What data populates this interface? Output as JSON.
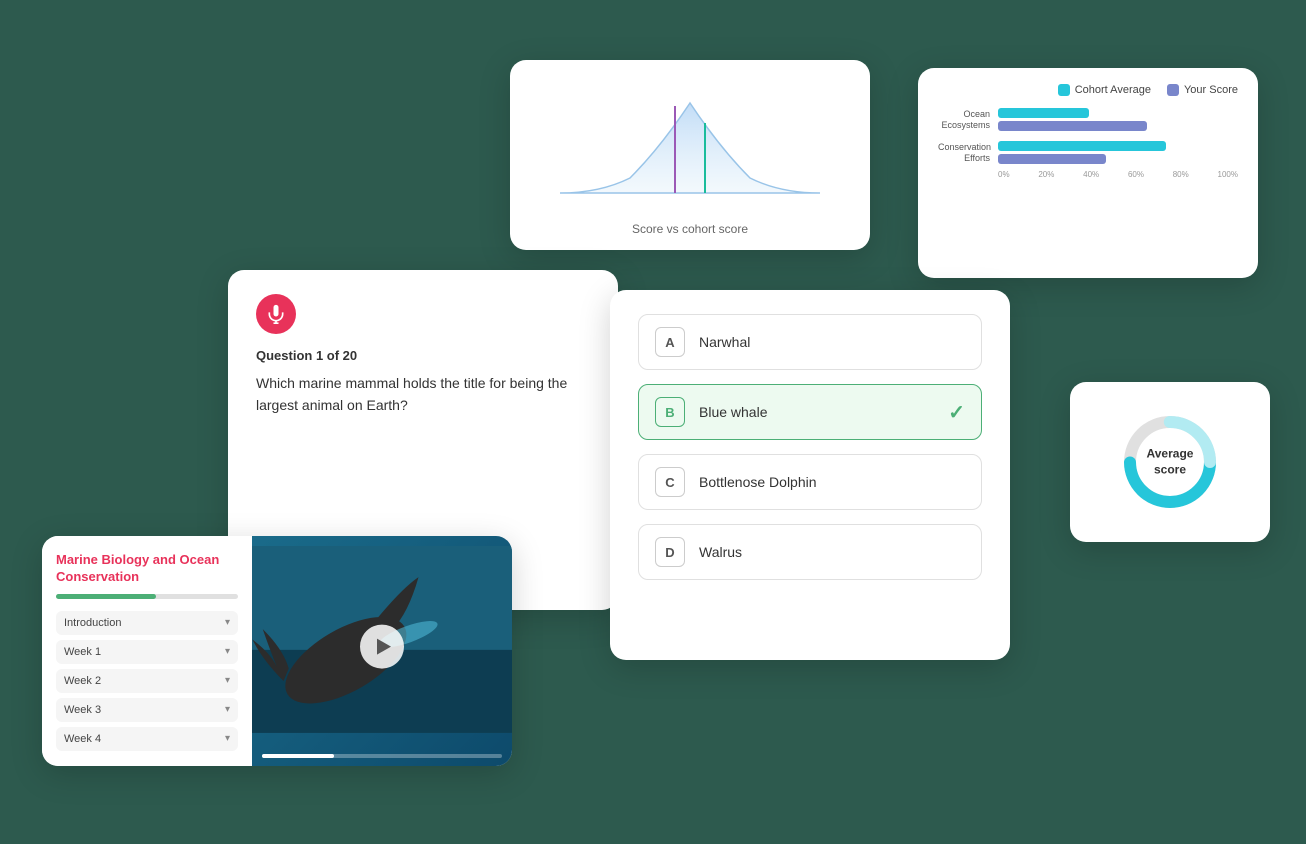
{
  "scoreCohort": {
    "label": "Score vs cohort score"
  },
  "barChart": {
    "legend": {
      "cohortColor": "#26c6da",
      "yourScoreColor": "#7986cb",
      "cohortLabel": "Cohort Average",
      "yourScoreLabel": "Your Score"
    },
    "rows": [
      {
        "label": "Ocean\nEcosystems",
        "cohortWidth": "38%",
        "yourWidth": "62%"
      },
      {
        "label": "Conservation\nEfforts",
        "cohortWidth": "70%",
        "yourWidth": "45%"
      }
    ],
    "axisLabels": [
      "0%",
      "20%",
      "40%",
      "60%",
      "80%",
      "100%"
    ]
  },
  "quiz": {
    "questionLabel": "Question 1 of 20",
    "questionText": "Which marine mammal holds the title for being the largest animal on Earth?",
    "answers": [
      {
        "letter": "A",
        "text": "Narwhal",
        "selected": false
      },
      {
        "letter": "B",
        "text": "Blue whale",
        "selected": true
      },
      {
        "letter": "C",
        "text": "Bottlenose Dolphin",
        "selected": false
      },
      {
        "letter": "D",
        "text": "Walrus",
        "selected": false
      }
    ]
  },
  "course": {
    "title": "Marine Biology and Ocean Conservation",
    "weeks": [
      {
        "label": "Introduction"
      },
      {
        "label": "Week 1"
      },
      {
        "label": "Week 2"
      },
      {
        "label": "Week 3"
      },
      {
        "label": "Week 4"
      }
    ]
  },
  "avgScore": {
    "label": "Average\nscore"
  }
}
